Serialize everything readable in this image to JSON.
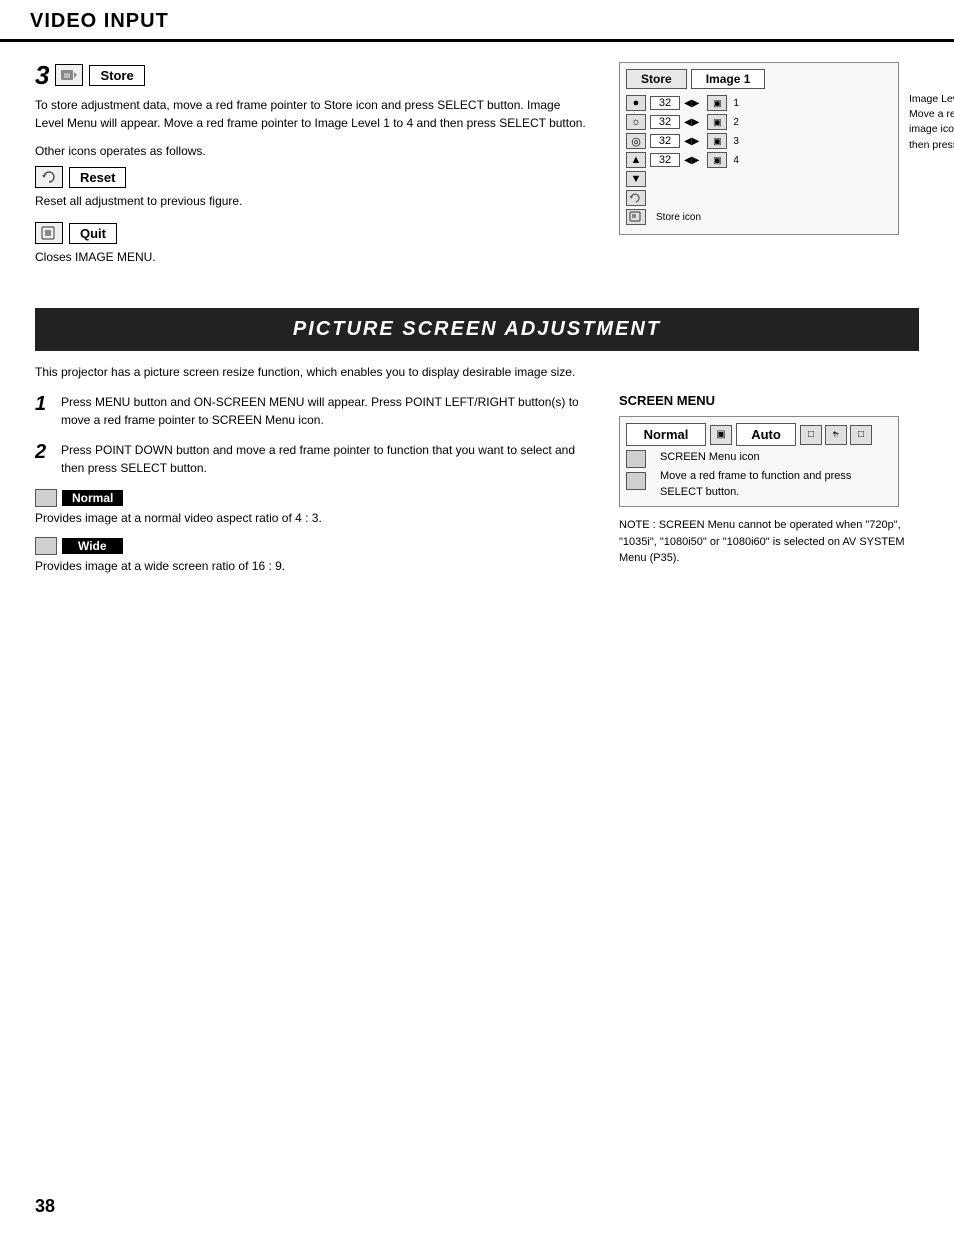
{
  "header": {
    "title": "VIDEO INPUT"
  },
  "step3": {
    "number": "3",
    "icon_label": "Store",
    "description": "To store adjustment data, move a red frame pointer to Store icon and press SELECT button.  Image Level Menu will appear. Move a red frame pointer to Image Level 1 to 4 and then press SELECT button.",
    "other_icons_text": "Other icons operates as follows.",
    "reset_label": "Reset",
    "reset_desc": "Reset all adjustment to previous figure.",
    "quit_label": "Quit",
    "quit_desc": "Closes IMAGE MENU."
  },
  "image_menu_diagram": {
    "store_btn": "Store",
    "image1_btn": "Image 1",
    "rows": [
      {
        "value": "32"
      },
      {
        "value": "32"
      },
      {
        "value": "32"
      },
      {
        "value": "32"
      }
    ],
    "annotation": "Image Level Menu\nMove a red frame pointer to\nimage icon to be set and\nthen press SELECT button.",
    "store_icon_label": "Store icon"
  },
  "psa_section": {
    "title": "PICTURE SCREEN ADJUSTMENT",
    "intro": "This projector has a picture screen resize function, which enables you to display desirable image size.",
    "step1": {
      "number": "1",
      "text": "Press MENU button and ON-SCREEN MENU will appear.  Press POINT LEFT/RIGHT button(s) to move a red frame pointer to SCREEN Menu icon."
    },
    "step2": {
      "number": "2",
      "text": "Press POINT DOWN button and move a red frame pointer to function that you want to select and then press SELECT button."
    },
    "normal_label": "Normal",
    "normal_desc": "Provides image at a normal video aspect ratio of 4 : 3.",
    "wide_label": "Wide",
    "wide_desc": "Provides image at a wide screen ratio of 16 : 9.",
    "screen_menu": {
      "title": "SCREEN MENU",
      "normal_text": "Normal",
      "auto_text": "Auto",
      "screen_menu_icon_label": "SCREEN Menu icon",
      "move_text": "Move a red frame to function and press SELECT button."
    },
    "note": "NOTE : SCREEN Menu cannot be operated when \"720p\", \"1035i\", \"1080i50\" or \"1080i60\" is selected on AV SYSTEM Menu (P35)."
  },
  "footer": {
    "page_number": "38"
  }
}
